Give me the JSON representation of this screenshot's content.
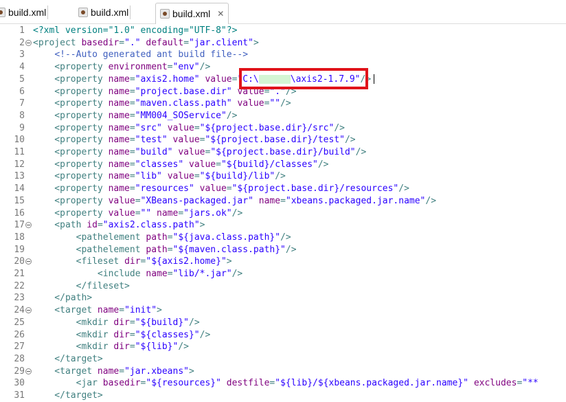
{
  "tabs": [
    {
      "label": "build.xml",
      "active": false
    },
    {
      "label": "build.xml",
      "active": false
    },
    {
      "label": "build.xml",
      "active": true
    }
  ],
  "highlight_color": "#e0141b",
  "lines": [
    {
      "n": "1",
      "parts": [
        [
          "p",
          "<?xml version=\"1.0\" encoding=\"UTF-8\"?>"
        ]
      ]
    },
    {
      "n": "2",
      "fold": true,
      "parts": [
        [
          "t",
          "<project "
        ],
        [
          "a",
          "basedir"
        ],
        [
          "t",
          "="
        ],
        [
          "s",
          "\".\""
        ],
        [
          "t",
          " "
        ],
        [
          "a",
          "default"
        ],
        [
          "t",
          "="
        ],
        [
          "s",
          "\"jar.client\""
        ],
        [
          "t",
          ">"
        ]
      ]
    },
    {
      "n": "3",
      "parts": [
        [
          "t",
          "    "
        ],
        [
          "c",
          "<!--Auto generated ant build file-->"
        ]
      ]
    },
    {
      "n": "4",
      "parts": [
        [
          "t",
          "    <property "
        ],
        [
          "a",
          "environment"
        ],
        [
          "t",
          "="
        ],
        [
          "s",
          "\"env\""
        ],
        [
          "t",
          "/>"
        ]
      ]
    },
    {
      "n": "5",
      "parts": [
        [
          "t",
          "    <property "
        ],
        [
          "a",
          "name"
        ],
        [
          "t",
          "="
        ],
        [
          "s",
          "\"axis2.home\""
        ],
        [
          "t",
          " "
        ],
        [
          "a",
          "value"
        ],
        [
          "t",
          "="
        ],
        [
          "s",
          "\"C:\\"
        ],
        [
          "r",
          ""
        ],
        [
          "s",
          "\\axis2-1.7.9\""
        ],
        [
          "t",
          "/>"
        ]
      ]
    },
    {
      "n": "6",
      "parts": [
        [
          "t",
          "    <property "
        ],
        [
          "a",
          "name"
        ],
        [
          "t",
          "="
        ],
        [
          "s",
          "\"project.base.dir\""
        ],
        [
          "t",
          " "
        ],
        [
          "a",
          "value"
        ],
        [
          "t",
          "="
        ],
        [
          "s",
          "\".\""
        ],
        [
          "t",
          "/>"
        ]
      ]
    },
    {
      "n": "7",
      "parts": [
        [
          "t",
          "    <property "
        ],
        [
          "a",
          "name"
        ],
        [
          "t",
          "="
        ],
        [
          "s",
          "\"maven.class.path\""
        ],
        [
          "t",
          " "
        ],
        [
          "a",
          "value"
        ],
        [
          "t",
          "="
        ],
        [
          "s",
          "\"\""
        ],
        [
          "t",
          "/>"
        ]
      ]
    },
    {
      "n": "8",
      "parts": [
        [
          "t",
          "    <property "
        ],
        [
          "a",
          "name"
        ],
        [
          "t",
          "="
        ],
        [
          "s",
          "\"MM004_SOService\""
        ],
        [
          "t",
          "/>"
        ]
      ]
    },
    {
      "n": "9",
      "parts": [
        [
          "t",
          "    <property "
        ],
        [
          "a",
          "name"
        ],
        [
          "t",
          "="
        ],
        [
          "s",
          "\"src\""
        ],
        [
          "t",
          " "
        ],
        [
          "a",
          "value"
        ],
        [
          "t",
          "="
        ],
        [
          "s",
          "\"${project.base.dir}/src\""
        ],
        [
          "t",
          "/>"
        ]
      ]
    },
    {
      "n": "10",
      "parts": [
        [
          "t",
          "    <property "
        ],
        [
          "a",
          "name"
        ],
        [
          "t",
          "="
        ],
        [
          "s",
          "\"test\""
        ],
        [
          "t",
          " "
        ],
        [
          "a",
          "value"
        ],
        [
          "t",
          "="
        ],
        [
          "s",
          "\"${project.base.dir}/test\""
        ],
        [
          "t",
          "/>"
        ]
      ]
    },
    {
      "n": "11",
      "parts": [
        [
          "t",
          "    <property "
        ],
        [
          "a",
          "name"
        ],
        [
          "t",
          "="
        ],
        [
          "s",
          "\"build\""
        ],
        [
          "t",
          " "
        ],
        [
          "a",
          "value"
        ],
        [
          "t",
          "="
        ],
        [
          "s",
          "\"${project.base.dir}/build\""
        ],
        [
          "t",
          "/>"
        ]
      ]
    },
    {
      "n": "12",
      "parts": [
        [
          "t",
          "    <property "
        ],
        [
          "a",
          "name"
        ],
        [
          "t",
          "="
        ],
        [
          "s",
          "\"classes\""
        ],
        [
          "t",
          " "
        ],
        [
          "a",
          "value"
        ],
        [
          "t",
          "="
        ],
        [
          "s",
          "\"${build}/classes\""
        ],
        [
          "t",
          "/>"
        ]
      ]
    },
    {
      "n": "13",
      "parts": [
        [
          "t",
          "    <property "
        ],
        [
          "a",
          "name"
        ],
        [
          "t",
          "="
        ],
        [
          "s",
          "\"lib\""
        ],
        [
          "t",
          " "
        ],
        [
          "a",
          "value"
        ],
        [
          "t",
          "="
        ],
        [
          "s",
          "\"${build}/lib\""
        ],
        [
          "t",
          "/>"
        ]
      ]
    },
    {
      "n": "14",
      "parts": [
        [
          "t",
          "    <property "
        ],
        [
          "a",
          "name"
        ],
        [
          "t",
          "="
        ],
        [
          "s",
          "\"resources\""
        ],
        [
          "t",
          " "
        ],
        [
          "a",
          "value"
        ],
        [
          "t",
          "="
        ],
        [
          "s",
          "\"${project.base.dir}/resources\""
        ],
        [
          "t",
          "/>"
        ]
      ]
    },
    {
      "n": "15",
      "parts": [
        [
          "t",
          "    <property "
        ],
        [
          "a",
          "value"
        ],
        [
          "t",
          "="
        ],
        [
          "s",
          "\"XBeans-packaged.jar\""
        ],
        [
          "t",
          " "
        ],
        [
          "a",
          "name"
        ],
        [
          "t",
          "="
        ],
        [
          "s",
          "\"xbeans.packaged.jar.name\""
        ],
        [
          "t",
          "/>"
        ]
      ]
    },
    {
      "n": "16",
      "parts": [
        [
          "t",
          "    <property "
        ],
        [
          "a",
          "value"
        ],
        [
          "t",
          "="
        ],
        [
          "s",
          "\"\""
        ],
        [
          "t",
          " "
        ],
        [
          "a",
          "name"
        ],
        [
          "t",
          "="
        ],
        [
          "s",
          "\"jars.ok\""
        ],
        [
          "t",
          "/>"
        ]
      ]
    },
    {
      "n": "17",
      "fold": true,
      "parts": [
        [
          "t",
          "    <path "
        ],
        [
          "a",
          "id"
        ],
        [
          "t",
          "="
        ],
        [
          "s",
          "\"axis2.class.path\""
        ],
        [
          "t",
          ">"
        ]
      ]
    },
    {
      "n": "18",
      "parts": [
        [
          "t",
          "        <pathelement "
        ],
        [
          "a",
          "path"
        ],
        [
          "t",
          "="
        ],
        [
          "s",
          "\"${java.class.path}\""
        ],
        [
          "t",
          "/>"
        ]
      ]
    },
    {
      "n": "19",
      "parts": [
        [
          "t",
          "        <pathelement "
        ],
        [
          "a",
          "path"
        ],
        [
          "t",
          "="
        ],
        [
          "s",
          "\"${maven.class.path}\""
        ],
        [
          "t",
          "/>"
        ]
      ]
    },
    {
      "n": "20",
      "fold": true,
      "parts": [
        [
          "t",
          "        <fileset "
        ],
        [
          "a",
          "dir"
        ],
        [
          "t",
          "="
        ],
        [
          "s",
          "\"${axis2.home}\""
        ],
        [
          "t",
          ">"
        ]
      ]
    },
    {
      "n": "21",
      "parts": [
        [
          "t",
          "            <include "
        ],
        [
          "a",
          "name"
        ],
        [
          "t",
          "="
        ],
        [
          "s",
          "\"lib/*.jar\""
        ],
        [
          "t",
          "/>"
        ]
      ]
    },
    {
      "n": "22",
      "parts": [
        [
          "t",
          "        </fileset>"
        ]
      ]
    },
    {
      "n": "23",
      "parts": [
        [
          "t",
          "    </path>"
        ]
      ]
    },
    {
      "n": "24",
      "fold": true,
      "parts": [
        [
          "t",
          "    <target "
        ],
        [
          "a",
          "name"
        ],
        [
          "t",
          "="
        ],
        [
          "s",
          "\"init\""
        ],
        [
          "t",
          ">"
        ]
      ]
    },
    {
      "n": "25",
      "parts": [
        [
          "t",
          "        <mkdir "
        ],
        [
          "a",
          "dir"
        ],
        [
          "t",
          "="
        ],
        [
          "s",
          "\"${build}\""
        ],
        [
          "t",
          "/>"
        ]
      ]
    },
    {
      "n": "26",
      "parts": [
        [
          "t",
          "        <mkdir "
        ],
        [
          "a",
          "dir"
        ],
        [
          "t",
          "="
        ],
        [
          "s",
          "\"${classes}\""
        ],
        [
          "t",
          "/>"
        ]
      ]
    },
    {
      "n": "27",
      "parts": [
        [
          "t",
          "        <mkdir "
        ],
        [
          "a",
          "dir"
        ],
        [
          "t",
          "="
        ],
        [
          "s",
          "\"${lib}\""
        ],
        [
          "t",
          "/>"
        ]
      ]
    },
    {
      "n": "28",
      "parts": [
        [
          "t",
          "    </target>"
        ]
      ]
    },
    {
      "n": "29",
      "fold": true,
      "parts": [
        [
          "t",
          "    <target "
        ],
        [
          "a",
          "name"
        ],
        [
          "t",
          "="
        ],
        [
          "s",
          "\"jar.xbeans\""
        ],
        [
          "t",
          ">"
        ]
      ]
    },
    {
      "n": "30",
      "parts": [
        [
          "t",
          "        <jar "
        ],
        [
          "a",
          "basedir"
        ],
        [
          "t",
          "="
        ],
        [
          "s",
          "\"${resources}\""
        ],
        [
          "t",
          " "
        ],
        [
          "a",
          "destfile"
        ],
        [
          "t",
          "="
        ],
        [
          "s",
          "\"${lib}/${xbeans.packaged.jar.name}\""
        ],
        [
          "t",
          " "
        ],
        [
          "a",
          "excludes"
        ],
        [
          "t",
          "="
        ],
        [
          "s",
          "\"**"
        ]
      ]
    },
    {
      "n": "31",
      "parts": [
        [
          "t",
          "    </target>"
        ]
      ]
    }
  ]
}
